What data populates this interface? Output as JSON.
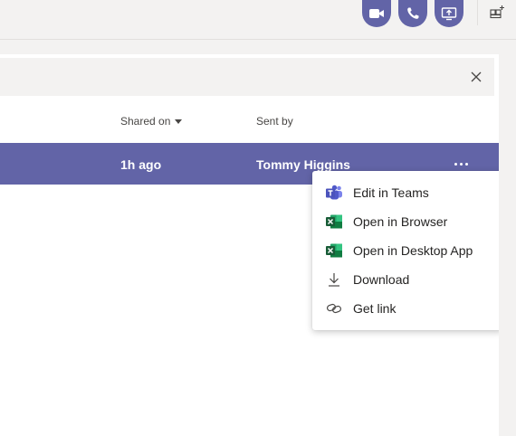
{
  "topbar": {
    "buttons": [
      {
        "name": "video-call",
        "icon": "video-camera-icon"
      },
      {
        "name": "audio-call",
        "icon": "phone-icon"
      },
      {
        "name": "share-screen",
        "icon": "screen-share-icon"
      }
    ],
    "add_people_icon": "add-people-icon"
  },
  "search": {
    "close_icon": "close-icon"
  },
  "table": {
    "headers": {
      "shared_on": "Shared on",
      "sent_by": "Sent by"
    },
    "row": {
      "shared_on": "1h ago",
      "sent_by": "Tommy Higgins"
    }
  },
  "context_menu": {
    "items": [
      {
        "label": "Edit in Teams",
        "icon": "teams-icon"
      },
      {
        "label": "Open in Browser",
        "icon": "excel-icon"
      },
      {
        "label": "Open in Desktop App",
        "icon": "excel-icon"
      },
      {
        "label": "Download",
        "icon": "download-icon"
      },
      {
        "label": "Get link",
        "icon": "link-icon"
      }
    ]
  },
  "colors": {
    "accent": "#6264a7",
    "excel": "#1d6f42",
    "background": "#f3f2f1",
    "surface": "#ffffff"
  }
}
